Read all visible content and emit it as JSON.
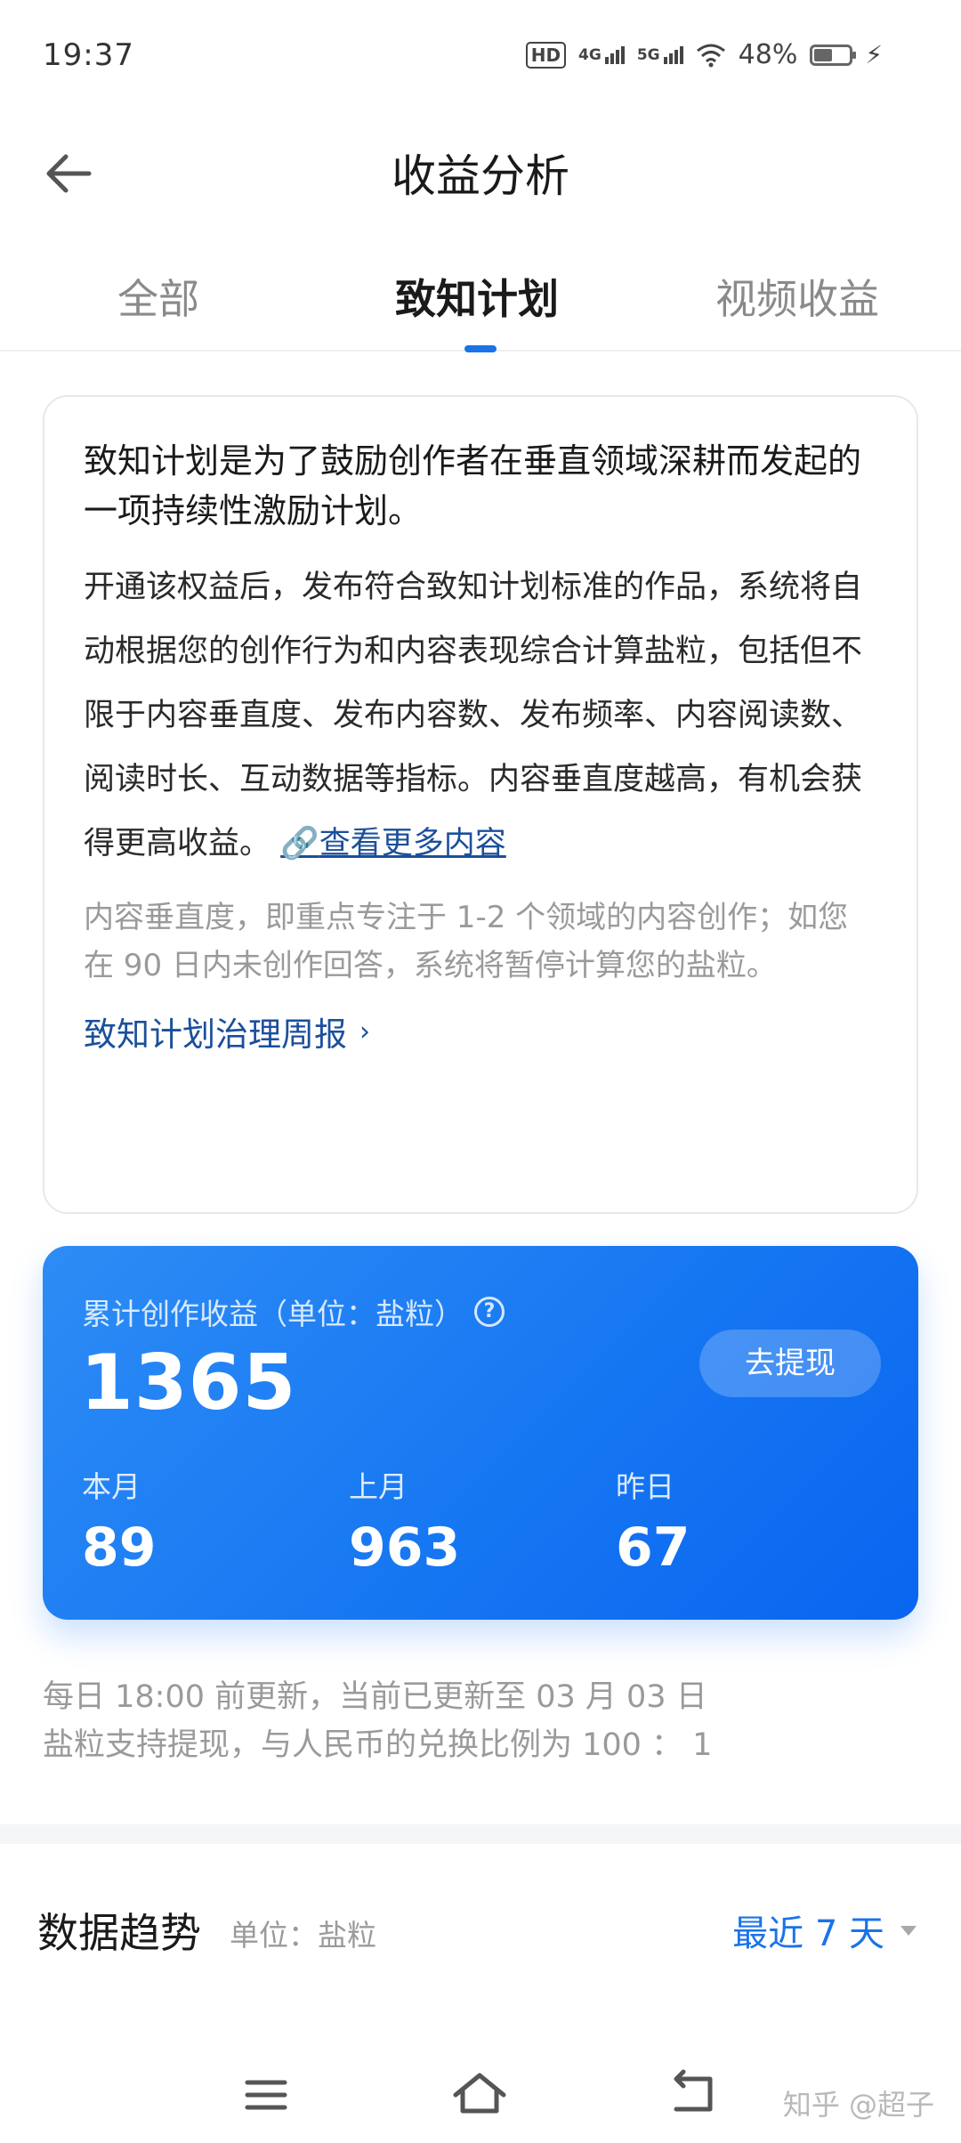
{
  "status_bar": {
    "time": "19:37",
    "hd_badge": "HD",
    "net1": "4G",
    "net2": "5G",
    "battery_pct": "48%",
    "icons": [
      "hd-icon",
      "signal-4g-icon",
      "signal-5g-icon",
      "wifi-icon",
      "battery-icon",
      "charging-icon"
    ]
  },
  "header": {
    "title": "收益分析",
    "back_icon": "arrow-left-icon"
  },
  "tabs": [
    {
      "label": "全部",
      "active": false
    },
    {
      "label": "致知计划",
      "active": true
    },
    {
      "label": "视频收益",
      "active": false
    }
  ],
  "intro": {
    "title": "致知计划是为了鼓励创作者在垂直领域深耕而发起的一项持续性激励计划。",
    "body": "开通该权益后，发布符合致知计划标准的作品，系统将自动根据您的创作行为和内容表现综合计算盐粒，包括但不限于内容垂直度、发布内容数、发布频率、内容阅读数、阅读时长、互动数据等指标。内容垂直度越高，有机会获得更高收益。",
    "link_icon": "🔗",
    "link_text": "查看更多内容",
    "note": "内容垂直度，即重点专注于 1-2 个领域的内容创作；如您在 90 日内未创作回答，系统将暂停计算您的盐粒。",
    "report_link": "致知计划治理周报",
    "report_chevron": "›"
  },
  "earnings": {
    "label": "累计创作收益（单位：盐粒）",
    "help_icon": "?",
    "total": "1365",
    "withdraw_label": "去提现",
    "this_month_label": "本月",
    "this_month_value": "89",
    "last_month_label": "上月",
    "last_month_value": "963",
    "yesterday_label": "昨日",
    "yesterday_value": "67"
  },
  "notes": {
    "update": "每日 18:00 前更新，当前已更新至 03 月 03 日",
    "exchange": "盐粒支持提现，与人民币的兑换比例为 100 ： 1"
  },
  "trend": {
    "title": "数据趋势",
    "unit": "单位：盐粒",
    "range": "最近 7 天"
  },
  "watermark": "知乎 @超子",
  "colors": {
    "accent": "#1a73e8",
    "card_gradient_start": "#2e8cf5",
    "card_gradient_end": "#0a65f0",
    "link": "#1b4f9c"
  }
}
